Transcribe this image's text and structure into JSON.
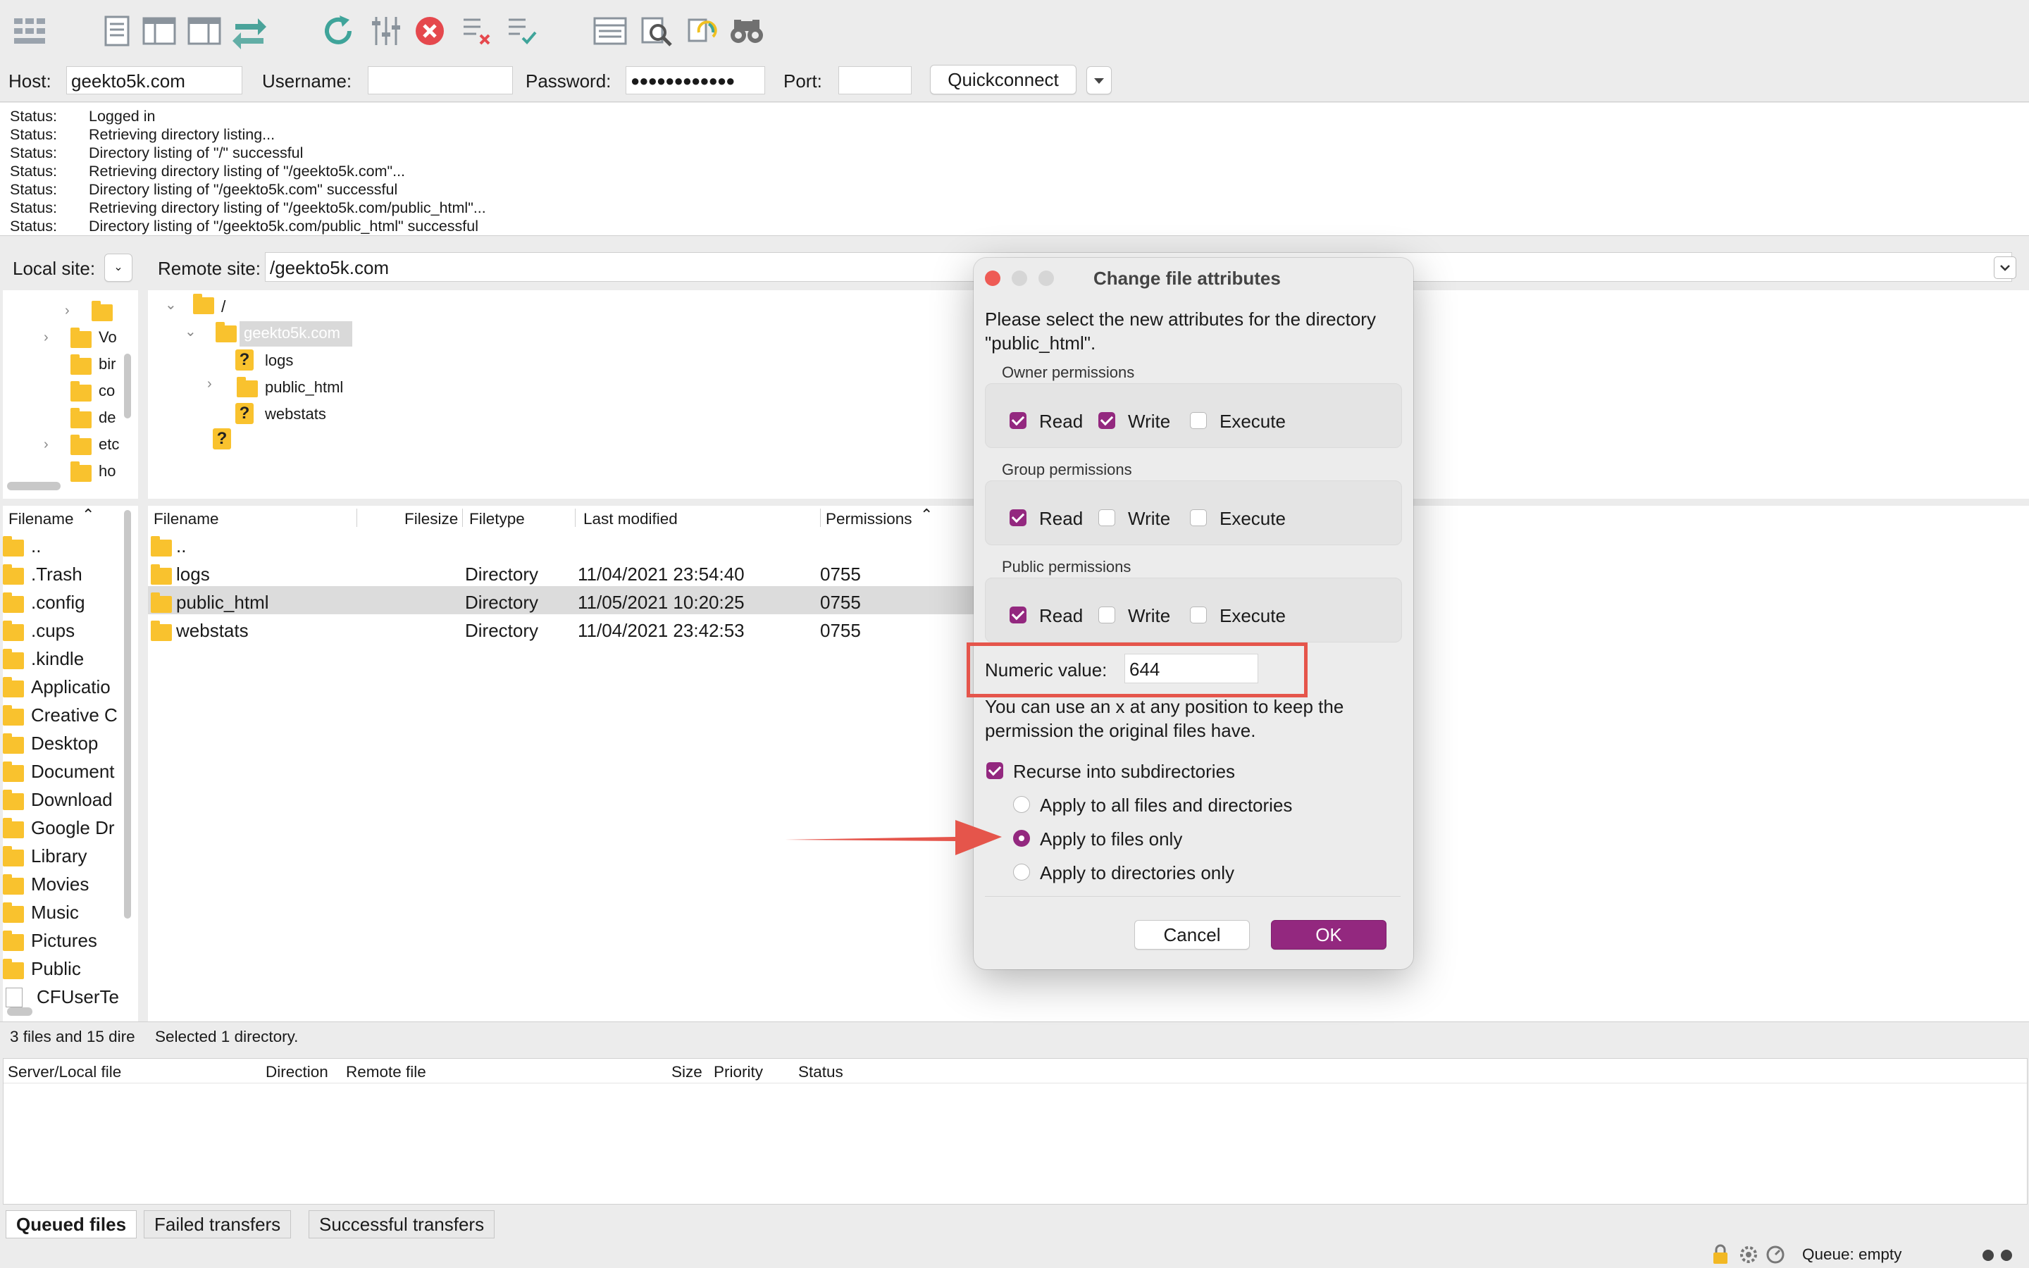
{
  "toolbar": {
    "icons": [
      "site-manager-icon",
      "message-log-icon",
      "local-tree-icon",
      "remote-tree-icon",
      "transfer-queue-icon",
      "refresh-icon",
      "process-queue-icon",
      "cancel-icon",
      "disconnect-icon",
      "reconnect-icon",
      "directory-comparison-icon",
      "filter-icon",
      "sync-browsing-icon",
      "search-icon"
    ],
    "accent_red": "#e5484d"
  },
  "quickconnect": {
    "host_label": "Host:",
    "host_value": "geekto5k.com",
    "username_label": "Username:",
    "username_value": "",
    "password_label": "Password:",
    "password_value": "●●●●●●●●●●●●",
    "port_label": "Port:",
    "port_value": "",
    "button": "Quickconnect",
    "dropdown_icon": "chevron-down-icon"
  },
  "log": [
    {
      "k": "Status:",
      "v": "Logged in"
    },
    {
      "k": "Status:",
      "v": "Retrieving directory listing..."
    },
    {
      "k": "Status:",
      "v": "Directory listing of \"/\" successful"
    },
    {
      "k": "Status:",
      "v": "Retrieving directory listing of \"/geekto5k.com\"..."
    },
    {
      "k": "Status:",
      "v": "Directory listing of \"/geekto5k.com\" successful"
    },
    {
      "k": "Status:",
      "v": "Retrieving directory listing of \"/geekto5k.com/public_html\"..."
    },
    {
      "k": "Status:",
      "v": "Directory listing of \"/geekto5k.com/public_html\" successful"
    }
  ],
  "local": {
    "site_label": "Local site:",
    "site_value": "/",
    "tree": [
      "",
      "Vo",
      "bir",
      "co",
      "de",
      "etc",
      "ho"
    ],
    "header": "Filename",
    "files": [
      "..",
      ".Trash",
      ".config",
      ".cups",
      ".kindle",
      "Applicatio",
      "Creative C",
      "Desktop",
      "Document",
      "Download",
      "Google Dr",
      "Library",
      "Movies",
      "Music",
      "Pictures",
      "Public",
      "CFUserTe"
    ],
    "status": "3 files and 15 dire"
  },
  "remote": {
    "site_label": "Remote site:",
    "site_value": "/geekto5k.com",
    "tree": {
      "root": "/",
      "selected": "geekto5k.com",
      "children": [
        "logs",
        "public_html",
        "webstats"
      ]
    },
    "headers": {
      "filename": "Filename",
      "filesize": "Filesize",
      "filetype": "Filetype",
      "modified": "Last modified",
      "permissions": "Permissions"
    },
    "rows": [
      {
        "name": "..",
        "type": "",
        "modified": "",
        "perm": ""
      },
      {
        "name": "logs",
        "type": "Directory",
        "modified": "11/04/2021 23:54:40",
        "perm": "0755"
      },
      {
        "name": "public_html",
        "type": "Directory",
        "modified": "11/05/2021 10:20:25",
        "perm": "0755"
      },
      {
        "name": "webstats",
        "type": "Directory",
        "modified": "11/04/2021 23:42:53",
        "perm": "0755"
      }
    ],
    "status": "Selected 1 directory."
  },
  "dialog": {
    "title": "Change file attributes",
    "intro_line1": "Please select the new attributes for the directory",
    "intro_line2": "\"public_html\".",
    "groups": [
      {
        "label": "Owner permissions",
        "read": true,
        "write": true,
        "execute": false
      },
      {
        "label": "Group permissions",
        "read": true,
        "write": false,
        "execute": false
      },
      {
        "label": "Public permissions",
        "read": true,
        "write": false,
        "execute": false
      }
    ],
    "read_label": "Read",
    "write_label": "Write",
    "execute_label": "Execute",
    "numeric_label": "Numeric value:",
    "numeric_value": "644",
    "hint_line1": "You can use an x at any position to keep the",
    "hint_line2": "permission the original files have.",
    "recurse_label": "Recurse into subdirectories",
    "recurse_checked": true,
    "options": [
      {
        "label": "Apply to all files and directories",
        "selected": false
      },
      {
        "label": "Apply to files only",
        "selected": true
      },
      {
        "label": "Apply to directories only",
        "selected": false
      }
    ],
    "cancel": "Cancel",
    "ok": "OK",
    "accent": "#93287f"
  },
  "annotation": {
    "highlight_color": "#e5554b"
  },
  "queue": {
    "headers": {
      "server_local": "Server/Local file",
      "direction": "Direction",
      "remote": "Remote file",
      "size": "Size",
      "priority": "Priority",
      "status": "Status"
    },
    "tabs": [
      "Queued files",
      "Failed transfers",
      "Successful transfers"
    ],
    "queue_status": "Queue: empty"
  }
}
